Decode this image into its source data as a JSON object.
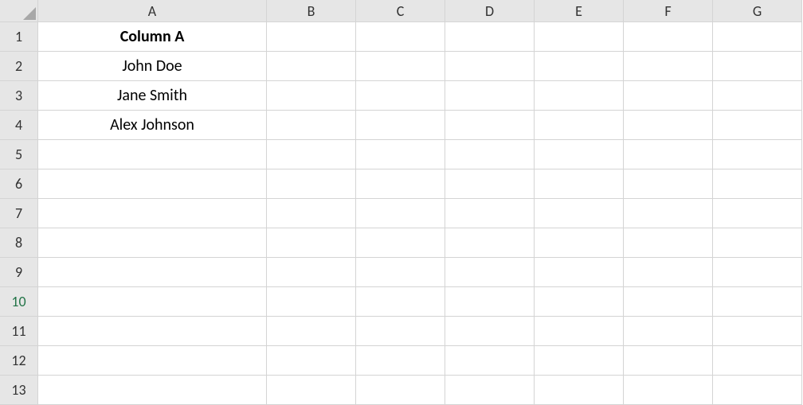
{
  "columns": [
    "A",
    "B",
    "C",
    "D",
    "E",
    "F",
    "G"
  ],
  "rows": [
    "1",
    "2",
    "3",
    "4",
    "5",
    "6",
    "7",
    "8",
    "9",
    "10",
    "11",
    "12",
    "13"
  ],
  "selected_row_index": 9,
  "cells": {
    "A1": "Column A",
    "A2": "John Doe",
    "A3": "Jane Smith",
    "A4": "Alex Johnson"
  },
  "chart_data": {
    "type": "table",
    "headers": [
      "Column A"
    ],
    "rows": [
      [
        "John Doe"
      ],
      [
        "Jane Smith"
      ],
      [
        "Alex Johnson"
      ]
    ]
  }
}
